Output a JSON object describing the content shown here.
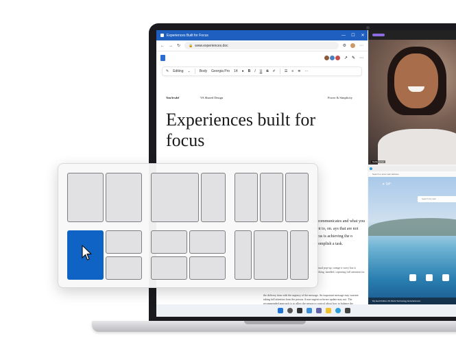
{
  "browser": {
    "window_title": "Experiences Built for Focus",
    "url": "www.experiences.doc",
    "toolbar": {
      "mode": "Editing",
      "style": "Body",
      "font": "Georgia Pro",
      "size": "14"
    }
  },
  "document": {
    "brand": "VanArsdel",
    "shared_design": "VA Shared Design",
    "tagline": "Power & Simplicity",
    "headline": "Experiences built for focus",
    "paragraph": "gy communicates and what you want to, on. ays that are not Focus is achieving the o accomplish a task.",
    "small_text": "e a visual pop-up, orange n wavy has is something. handled, capturing full attention for",
    "footer_text": "the delivery item with the urgency of the message. An important message may warrant taking full attention from the person. A non-urgent software update may not. The recommended approach is to allow the person to control about how to balance the benefit of the interruption with the cost of interrupting the"
  },
  "video_call": {
    "tag": "Nadia Jamal"
  },
  "edge": {
    "address": "Search or enter web address",
    "weather": "☀ 54°",
    "search_placeholder": "Search the web",
    "news_bar": "My feed   Politics   US   World   Technology   Entertainment"
  },
  "colors": {
    "accent": "#0f63c4",
    "titlebar": "#1f5fbf"
  }
}
